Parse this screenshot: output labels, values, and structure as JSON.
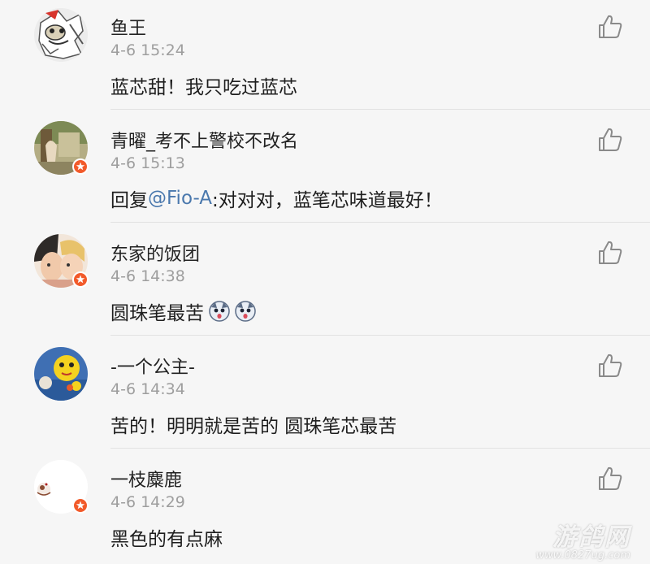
{
  "comments": [
    {
      "username": "鱼王",
      "time": "4-6 15:24",
      "content": "蓝芯甜！我只吃过蓝芯",
      "verified": false
    },
    {
      "username": "青曜_考不上警校不改名",
      "time": "4-6 15:13",
      "content_prefix": "回复",
      "mention": "@Fio-A",
      "content": ":对对对，蓝笔芯味道最好！",
      "verified": true
    },
    {
      "username": "东家的饭团",
      "time": "4-6 14:38",
      "content": "圆珠笔最苦",
      "emojis": [
        "surprised-dog-emoji",
        "surprised-dog-emoji"
      ],
      "verified": true
    },
    {
      "username": "-一个公主-",
      "time": "4-6 14:34",
      "content": "苦的！明明就是苦的 圆珠笔芯最苦",
      "verified": false
    },
    {
      "username": "一枝麋鹿",
      "time": "4-6 14:29",
      "content": "黑色的有点麻",
      "verified": true
    }
  ],
  "watermark": {
    "logo": "游鸽网",
    "url": "www.0827ug.com"
  },
  "colors": {
    "background": "#f6f6f6",
    "mention": "#4a78ad",
    "verified_badge": "#f25a2a",
    "timestamp": "#9e9e9e",
    "like_icon": "#8a8a8a"
  },
  "icons": {
    "like": "thumbs-up-icon",
    "verified": "verified-badge-icon"
  }
}
